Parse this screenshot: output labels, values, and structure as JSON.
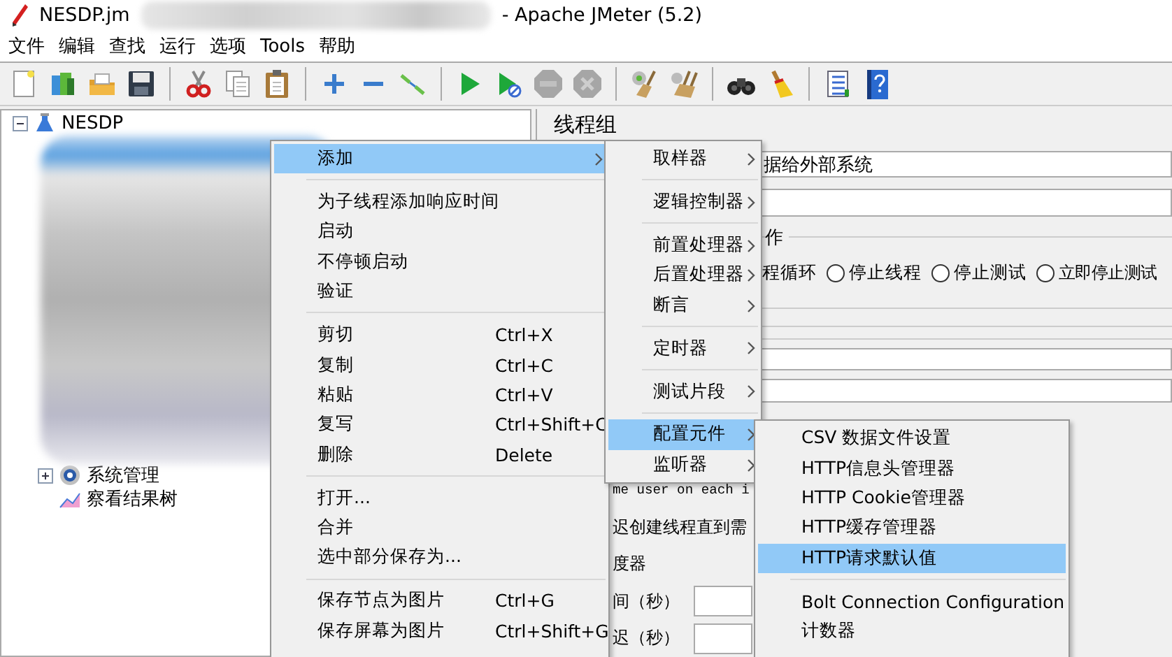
{
  "window": {
    "title": "NESDP.jm",
    "app_title": "- Apache JMeter (5.2)"
  },
  "menubar": [
    {
      "label": "文件"
    },
    {
      "label": "编辑"
    },
    {
      "label": "查找"
    },
    {
      "label": "运行"
    },
    {
      "label": "选项"
    },
    {
      "label": "Tools"
    },
    {
      "label": "帮助"
    }
  ],
  "toolbar": [
    {
      "kind": "new"
    },
    {
      "kind": "templates"
    },
    {
      "kind": "open"
    },
    {
      "kind": "save"
    },
    {
      "kind": "separator"
    },
    {
      "kind": "cut"
    },
    {
      "kind": "copy"
    },
    {
      "kind": "paste"
    },
    {
      "kind": "separator"
    },
    {
      "kind": "expand"
    },
    {
      "kind": "collapse"
    },
    {
      "kind": "toggle"
    },
    {
      "kind": "separator"
    },
    {
      "kind": "start",
      "disabled": false
    },
    {
      "kind": "start-no-pause",
      "disabled": false
    },
    {
      "kind": "stop",
      "disabled": true
    },
    {
      "kind": "shutdown",
      "disabled": true
    },
    {
      "kind": "separator"
    },
    {
      "kind": "clear"
    },
    {
      "kind": "clear-all"
    },
    {
      "kind": "separator"
    },
    {
      "kind": "search"
    },
    {
      "kind": "reset-search"
    },
    {
      "kind": "separator"
    },
    {
      "kind": "functions"
    },
    {
      "kind": "help"
    }
  ],
  "tree": [
    {
      "label": "NESDP",
      "kind": "plan",
      "expanded": true,
      "children": [
        {
          "label": "系统管理",
          "kind": "group",
          "expanded": false
        },
        {
          "label": "察看结果树",
          "kind": "listener"
        }
      ]
    }
  ],
  "panel": {
    "title": "线程组",
    "name_value": "据给外部系统",
    "action_label": "作",
    "action_options": [
      {
        "label": "程循环",
        "kind": "text"
      },
      {
        "label": "停止线程",
        "kind": "radio",
        "selected": false
      },
      {
        "label": "停止测试",
        "kind": "radio",
        "selected": false
      },
      {
        "label": "立即停止测试",
        "kind": "radio",
        "selected": false
      }
    ],
    "lines": [
      {
        "text": "me user on each i",
        "kind": "mono"
      },
      {
        "text": "迟创建线程直到需",
        "kind": "text"
      },
      {
        "text": "度器",
        "kind": "text"
      },
      {
        "text": "间（秒）",
        "kind": "field"
      },
      {
        "text": "迟（秒）",
        "kind": "field"
      }
    ]
  },
  "context_menus": [
    {
      "items": [
        {
          "kind": "item",
          "label": "添加",
          "submenu": true,
          "selected": true
        },
        {
          "kind": "separator"
        },
        {
          "kind": "item",
          "label": "为子线程添加响应时间",
          "selected": false
        },
        {
          "kind": "item",
          "label": "启动",
          "selected": false
        },
        {
          "kind": "item",
          "label": "不停顿启动",
          "selected": false
        },
        {
          "kind": "item",
          "label": "验证",
          "selected": false
        },
        {
          "kind": "separator"
        },
        {
          "kind": "item",
          "label": "剪切",
          "shortcut": "Ctrl+X",
          "selected": false
        },
        {
          "kind": "item",
          "label": "复制",
          "shortcut": "Ctrl+C",
          "selected": false
        },
        {
          "kind": "item",
          "label": "粘贴",
          "shortcut": "Ctrl+V",
          "selected": false
        },
        {
          "kind": "item",
          "label": "复写",
          "shortcut": "Ctrl+Shift+C",
          "selected": false
        },
        {
          "kind": "item",
          "label": "删除",
          "shortcut": "Delete",
          "selected": false
        },
        {
          "kind": "separator"
        },
        {
          "kind": "item",
          "label": "打开...",
          "selected": false
        },
        {
          "kind": "item",
          "label": "合并",
          "selected": false
        },
        {
          "kind": "item",
          "label": "选中部分保存为...",
          "selected": false
        },
        {
          "kind": "separator"
        },
        {
          "kind": "item",
          "label": "保存节点为图片",
          "shortcut": "Ctrl+G",
          "selected": false
        },
        {
          "kind": "item",
          "label": "保存屏幕为图片",
          "shortcut": "Ctrl+Shift+G",
          "selected": false
        }
      ]
    },
    {
      "items": [
        {
          "kind": "item",
          "label": "取样器",
          "submenu": true,
          "selected": false
        },
        {
          "kind": "separator"
        },
        {
          "kind": "item",
          "label": "逻辑控制器",
          "submenu": true,
          "selected": false
        },
        {
          "kind": "separator"
        },
        {
          "kind": "item",
          "label": "前置处理器",
          "submenu": true,
          "selected": false
        },
        {
          "kind": "item",
          "label": "后置处理器",
          "submenu": true,
          "selected": false
        },
        {
          "kind": "item",
          "label": "断言",
          "submenu": true,
          "selected": false
        },
        {
          "kind": "separator"
        },
        {
          "kind": "item",
          "label": "定时器",
          "submenu": true,
          "selected": false
        },
        {
          "kind": "separator"
        },
        {
          "kind": "item",
          "label": "测试片段",
          "submenu": true,
          "selected": false
        },
        {
          "kind": "separator"
        },
        {
          "kind": "item",
          "label": "配置元件",
          "submenu": true,
          "selected": true
        },
        {
          "kind": "item",
          "label": "监听器",
          "submenu": true,
          "selected": false
        }
      ]
    },
    {
      "items": [
        {
          "kind": "item",
          "label": "CSV 数据文件设置",
          "selected": false
        },
        {
          "kind": "item",
          "label": "HTTP信息头管理器",
          "selected": false
        },
        {
          "kind": "item",
          "label": "HTTP Cookie管理器",
          "selected": false
        },
        {
          "kind": "item",
          "label": "HTTP缓存管理器",
          "selected": false
        },
        {
          "kind": "item",
          "label": "HTTP请求默认值",
          "selected": true
        },
        {
          "kind": "separator"
        },
        {
          "kind": "item",
          "label": "Bolt Connection Configuration",
          "selected": false
        },
        {
          "kind": "item",
          "label": "计数器",
          "selected": false
        }
      ]
    }
  ]
}
